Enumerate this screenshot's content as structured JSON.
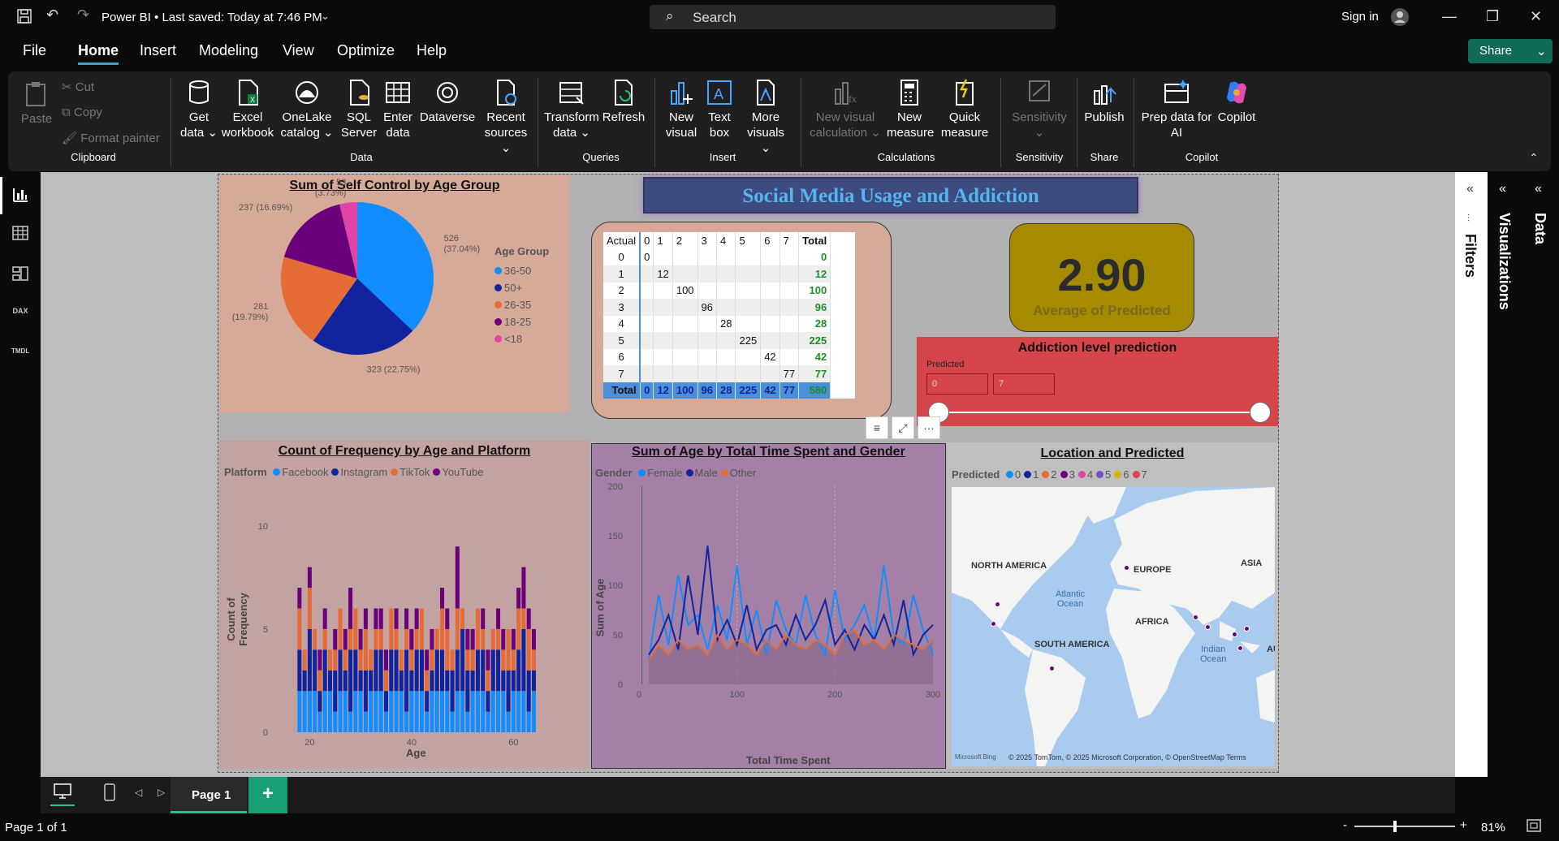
{
  "titlebar": {
    "app_title": "Power BI • Last saved: Today at 7:46 PM",
    "search_placeholder": "Search",
    "sign_in": "Sign in"
  },
  "menu": [
    "File",
    "Home",
    "Insert",
    "Modeling",
    "View",
    "Optimize",
    "Help"
  ],
  "share_label": "Share",
  "ribbon": {
    "clipboard": {
      "paste": "Paste",
      "cut": "Cut",
      "copy": "Copy",
      "format_painter": "Format painter",
      "group": "Clipboard"
    },
    "data": {
      "get_data": "Get data",
      "excel": "Excel workbook",
      "onelake": "OneLake catalog",
      "sql": "SQL Server",
      "enter": "Enter data",
      "dataverse": "Dataverse",
      "recent": "Recent sources",
      "group": "Data"
    },
    "queries": {
      "transform": "Transform data",
      "refresh": "Refresh",
      "group": "Queries"
    },
    "insert": {
      "new_visual": "New visual",
      "text_box": "Text box",
      "more_visuals": "More visuals",
      "group": "Insert"
    },
    "calculations": {
      "new_visual_calc": "New visual calculation",
      "new_measure": "New measure",
      "quick_measure": "Quick measure",
      "group": "Calculations"
    },
    "sensitivity": {
      "label": "Sensitivity",
      "group": "Sensitivity"
    },
    "share": {
      "publish": "Publish",
      "group": "Share"
    },
    "copilot": {
      "prep": "Prep data for AI",
      "copilot": "Copilot",
      "group": "Copilot"
    }
  },
  "report": {
    "banner": "Social Media Usage and Addiction",
    "pie": {
      "title": "Sum of Self Control by Age Group",
      "legend_title": "Age Group",
      "legend": [
        "36-50",
        "50+",
        "26-35",
        "18-25",
        "<18"
      ],
      "colors": [
        "#118DFF",
        "#12239E",
        "#E66C37",
        "#6B007B",
        "#E044A7"
      ],
      "values": [
        526,
        323,
        281,
        237,
        53
      ],
      "labels": [
        "526\n(37.04%)",
        "323 (22.75%)",
        "281\n(19.79%)",
        "237 (16.69%)",
        "53\n(3.73%)"
      ]
    },
    "matrix": {
      "corner": "Actual",
      "columns": [
        "0",
        "1",
        "2",
        "3",
        "4",
        "5",
        "6",
        "7",
        "Total"
      ],
      "rows": [
        {
          "label": "0",
          "values": [
            "0",
            "",
            "",
            "",
            "",
            "",
            "",
            ""
          ],
          "total": "0"
        },
        {
          "label": "1",
          "values": [
            "",
            "12",
            "",
            "",
            "",
            "",
            "",
            ""
          ],
          "total": "12"
        },
        {
          "label": "2",
          "values": [
            "",
            "",
            "100",
            "",
            "",
            "",
            "",
            ""
          ],
          "total": "100"
        },
        {
          "label": "3",
          "values": [
            "",
            "",
            "",
            "96",
            "",
            "",
            "",
            ""
          ],
          "total": "96"
        },
        {
          "label": "4",
          "values": [
            "",
            "",
            "",
            "",
            "28",
            "",
            "",
            ""
          ],
          "total": "28"
        },
        {
          "label": "5",
          "values": [
            "",
            "",
            "",
            "",
            "",
            "225",
            "",
            ""
          ],
          "total": "225"
        },
        {
          "label": "6",
          "values": [
            "",
            "",
            "",
            "",
            "",
            "",
            "42",
            ""
          ],
          "total": "42"
        },
        {
          "label": "7",
          "values": [
            "",
            "",
            "",
            "",
            "",
            "",
            "",
            "77"
          ],
          "total": "77"
        }
      ],
      "total_row": {
        "label": "Total",
        "values": [
          "0",
          "12",
          "100",
          "96",
          "28",
          "225",
          "42",
          "77"
        ],
        "total": "580"
      }
    },
    "card": {
      "value": "2.90",
      "label": "Average of Predicted"
    },
    "slicer": {
      "title": "Addiction level prediction",
      "field": "Predicted",
      "min": "0",
      "max": "7"
    },
    "bar_chart": {
      "title": "Count of Frequency by Age and Platform",
      "legend_title": "Platform",
      "xlabel": "Age",
      "ylabel": "Count of Frequency",
      "x_ticks": [
        "20",
        "40",
        "60"
      ],
      "y_ticks": [
        "0",
        "5",
        "10"
      ]
    },
    "line_chart": {
      "title": "Sum of Age by Total Time Spent and Gender",
      "legend_title": "Gender",
      "xlabel": "Total Time Spent",
      "ylabel": "Sum of Age",
      "x_ticks": [
        "0",
        "100",
        "200",
        "300"
      ],
      "y_ticks": [
        "0",
        "50",
        "100",
        "150",
        "200"
      ]
    },
    "map": {
      "title": "Location and Predicted",
      "legend_title": "Predicted",
      "legend": [
        "0",
        "1",
        "2",
        "3",
        "4",
        "5",
        "6",
        "7"
      ],
      "legend_colors": [
        "#118DFF",
        "#12239E",
        "#E66C37",
        "#6B007B",
        "#E044A7",
        "#744EC2",
        "#D9B300",
        "#D64550"
      ],
      "labels": {
        "na": "NORTH AMERICA",
        "eu": "EUROPE",
        "asia": "ASIA",
        "atl": "Atlantic\nOcean",
        "af": "AFRICA",
        "sa": "SOUTH AMERICA",
        "ind": "Indian\nOcean",
        "au": "AU"
      },
      "attribution": "© 2025 TomTom, © 2025 Microsoft Corporation, © OpenStreetMap  Terms",
      "bing": "Microsoft Bing"
    }
  },
  "chart_data": [
    {
      "type": "pie",
      "title": "Sum of Self Control by Age Group",
      "categories": [
        "36-50",
        "50+",
        "26-35",
        "18-25",
        "<18"
      ],
      "values": [
        526,
        323,
        281,
        237,
        53
      ]
    },
    {
      "type": "bar",
      "title": "Count of Frequency by Age and Platform",
      "xlabel": "Age",
      "ylabel": "Count of Frequency",
      "ylim": [
        0,
        12
      ],
      "x": [
        18,
        19,
        20,
        21,
        22,
        23,
        24,
        25,
        26,
        27,
        28,
        29,
        30,
        31,
        32,
        33,
        34,
        35,
        36,
        37,
        38,
        39,
        40,
        41,
        42,
        43,
        44,
        45,
        46,
        47,
        48,
        49,
        50,
        51,
        52,
        53,
        54,
        55,
        56,
        57,
        58,
        59,
        60,
        61,
        62,
        63,
        64
      ],
      "series": [
        {
          "name": "Facebook",
          "values": [
            2,
            2,
            2,
            2,
            1,
            2,
            2,
            1,
            2,
            2,
            1,
            2,
            2,
            1,
            2,
            2,
            2,
            1,
            2,
            2,
            2,
            1,
            2,
            2,
            2,
            1,
            2,
            2,
            2,
            2,
            1,
            2,
            2,
            1,
            2,
            2,
            2,
            1,
            2,
            2,
            2,
            1,
            2,
            2,
            2,
            1,
            2
          ]
        },
        {
          "name": "Instagram",
          "values": [
            2,
            1,
            3,
            2,
            1,
            2,
            1,
            2,
            2,
            1,
            3,
            2,
            1,
            2,
            1,
            2,
            2,
            1,
            2,
            2,
            1,
            3,
            1,
            2,
            2,
            1,
            1,
            2,
            2,
            1,
            2,
            2,
            3,
            2,
            1,
            2,
            2,
            1,
            2,
            2,
            1,
            2,
            1,
            2,
            3,
            2,
            1
          ]
        },
        {
          "name": "TikTok",
          "values": [
            2,
            1,
            2,
            1,
            1,
            1,
            1,
            1,
            2,
            1,
            1,
            2,
            1,
            2,
            1,
            1,
            1,
            1,
            2,
            1,
            1,
            1,
            1,
            1,
            2,
            1,
            1,
            1,
            2,
            2,
            1,
            2,
            1,
            1,
            1,
            2,
            1,
            1,
            1,
            1,
            1,
            2,
            1,
            2,
            1,
            2,
            1
          ]
        },
        {
          "name": "YouTube",
          "values": [
            1,
            0,
            1,
            0,
            1,
            1,
            0,
            1,
            0,
            1,
            2,
            0,
            1,
            1,
            0,
            1,
            1,
            1,
            0,
            1,
            0,
            1,
            1,
            1,
            0,
            1,
            1,
            0,
            1,
            1,
            0,
            3,
            0,
            1,
            1,
            0,
            1,
            1,
            0,
            1,
            1,
            0,
            1,
            1,
            2,
            1,
            1
          ]
        }
      ]
    },
    {
      "type": "line",
      "title": "Sum of Age by Total Time Spent and Gender",
      "xlabel": "Total Time Spent",
      "ylabel": "Sum of Age",
      "xlim": [
        0,
        300
      ],
      "ylim": [
        0,
        200
      ],
      "x": [
        10,
        20,
        30,
        40,
        50,
        60,
        70,
        80,
        90,
        100,
        110,
        120,
        130,
        140,
        150,
        160,
        170,
        180,
        190,
        200,
        210,
        220,
        230,
        240,
        250,
        260,
        270,
        280,
        290,
        300
      ],
      "series": [
        {
          "name": "Female",
          "values": [
            25,
            90,
            40,
            110,
            60,
            70,
            35,
            80,
            45,
            120,
            40,
            75,
            30,
            85,
            55,
            40,
            90,
            50,
            30,
            95,
            45,
            60,
            80,
            45,
            120,
            50,
            40,
            90,
            55,
            30
          ]
        },
        {
          "name": "Male",
          "values": [
            30,
            45,
            70,
            35,
            110,
            50,
            140,
            45,
            65,
            40,
            80,
            35,
            55,
            60,
            40,
            70,
            45,
            60,
            85,
            40,
            55,
            35,
            60,
            45,
            70,
            40,
            85,
            30,
            50,
            60
          ]
        },
        {
          "name": "Other",
          "values": [
            25,
            40,
            30,
            45,
            35,
            40,
            30,
            50,
            35,
            45,
            40,
            30,
            45,
            35,
            50,
            40,
            35,
            45,
            40,
            30,
            50,
            55,
            40,
            45,
            35,
            50,
            45,
            40,
            35,
            45
          ]
        }
      ]
    }
  ]
}
